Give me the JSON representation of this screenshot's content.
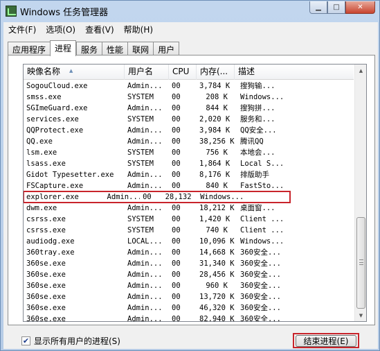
{
  "window": {
    "title": "Windows 任务管理器",
    "minimize_glyph": "▁",
    "maximize_glyph": "□",
    "close_glyph": "✕"
  },
  "menu": [
    "文件(F)",
    "选项(O)",
    "查看(V)",
    "帮助(H)"
  ],
  "tabs": [
    "应用程序",
    "进程",
    "服务",
    "性能",
    "联网",
    "用户"
  ],
  "active_tab": "进程",
  "columns": {
    "name": "映像名称",
    "user": "用户名",
    "cpu": "CPU",
    "mem": "内存(...",
    "desc": "描述"
  },
  "processes": [
    {
      "name": "SogouCloud.exe",
      "user": "Admin...",
      "cpu": "00",
      "mem": "3,784 K",
      "desc": "搜狗输..."
    },
    {
      "name": "smss.exe",
      "user": "SYSTEM",
      "cpu": "00",
      "mem": "208 K",
      "desc": "Windows..."
    },
    {
      "name": "SGImeGuard.exe",
      "user": "Admin...",
      "cpu": "00",
      "mem": "844 K",
      "desc": "搜狗拼..."
    },
    {
      "name": "services.exe",
      "user": "SYSTEM",
      "cpu": "00",
      "mem": "2,020 K",
      "desc": "服务和..."
    },
    {
      "name": "QQProtect.exe",
      "user": "Admin...",
      "cpu": "00",
      "mem": "3,984 K",
      "desc": "QQ安全..."
    },
    {
      "name": "QQ.exe",
      "user": "Admin...",
      "cpu": "00",
      "mem": "38,256 K",
      "desc": "腾讯QQ"
    },
    {
      "name": "lsm.exe",
      "user": "SYSTEM",
      "cpu": "00",
      "mem": "756 K",
      "desc": "本地会..."
    },
    {
      "name": "lsass.exe",
      "user": "SYSTEM",
      "cpu": "00",
      "mem": "1,864 K",
      "desc": "Local S..."
    },
    {
      "name": "Gidot Typesetter.exe",
      "user": "Admin...",
      "cpu": "00",
      "mem": "8,176 K",
      "desc": "排版助手"
    },
    {
      "name": "FSCapture.exe",
      "user": "Admin...",
      "cpu": "00",
      "mem": "840 K",
      "desc": "FastSto..."
    },
    {
      "name": "explorer.exe",
      "user": "Admin...",
      "cpu": "00",
      "mem": "28,132 K",
      "desc": "Windows..."
    },
    {
      "name": "dwm.exe",
      "user": "Admin...",
      "cpu": "00",
      "mem": "18,212 K",
      "desc": "桌面窗..."
    },
    {
      "name": "csrss.exe",
      "user": "SYSTEM",
      "cpu": "00",
      "mem": "1,420 K",
      "desc": "Client ..."
    },
    {
      "name": "csrss.exe",
      "user": "SYSTEM",
      "cpu": "00",
      "mem": "740 K",
      "desc": "Client ..."
    },
    {
      "name": "audiodg.exe",
      "user": "LOCAL...",
      "cpu": "00",
      "mem": "10,096 K",
      "desc": "Windows..."
    },
    {
      "name": "360tray.exe",
      "user": "Admin...",
      "cpu": "00",
      "mem": "14,668 K",
      "desc": "360安全..."
    },
    {
      "name": "360se.exe",
      "user": "Admin...",
      "cpu": "00",
      "mem": "31,340 K",
      "desc": "360安全..."
    },
    {
      "name": "360se.exe",
      "user": "Admin...",
      "cpu": "00",
      "mem": "28,456 K",
      "desc": "360安全..."
    },
    {
      "name": "360se.exe",
      "user": "Admin...",
      "cpu": "00",
      "mem": "960 K",
      "desc": "360安全..."
    },
    {
      "name": "360se.exe",
      "user": "Admin...",
      "cpu": "00",
      "mem": "13,720 K",
      "desc": "360安全..."
    },
    {
      "name": "360se.exe",
      "user": "Admin...",
      "cpu": "00",
      "mem": "46,320 K",
      "desc": "360安全..."
    },
    {
      "name": "360se.exe",
      "user": "Admin...",
      "cpu": "00",
      "mem": "82,940 K",
      "desc": "360安全..."
    }
  ],
  "highlighted_process": "explorer.exe",
  "highlight_color": "#c8242b",
  "show_all_users": {
    "label": "显示所有用户的进程(S)",
    "checked": true,
    "check_glyph": "✔"
  },
  "end_process_button": "结束进程(E)"
}
